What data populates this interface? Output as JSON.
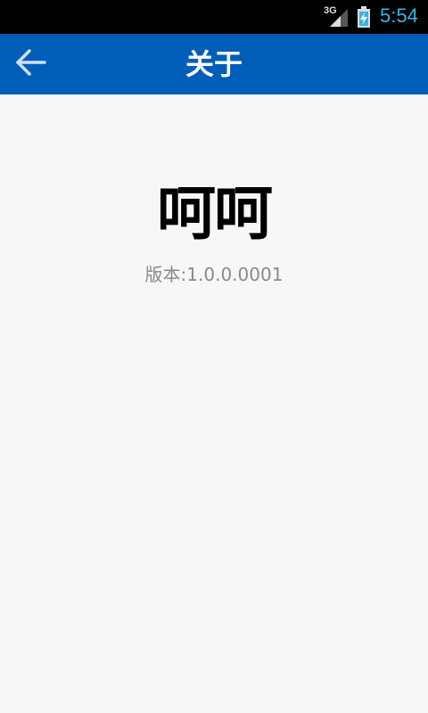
{
  "status_bar": {
    "network": "3G",
    "time": "5:54",
    "accent_color": "#33b5e5",
    "icons": [
      "signal-icon",
      "battery-charging-icon"
    ]
  },
  "action_bar": {
    "title": "关于",
    "background": "#005eb8",
    "back_icon": "arrow-left-icon"
  },
  "about": {
    "app_name": "呵呵",
    "version_text": "版本:1.0.0.0001"
  }
}
